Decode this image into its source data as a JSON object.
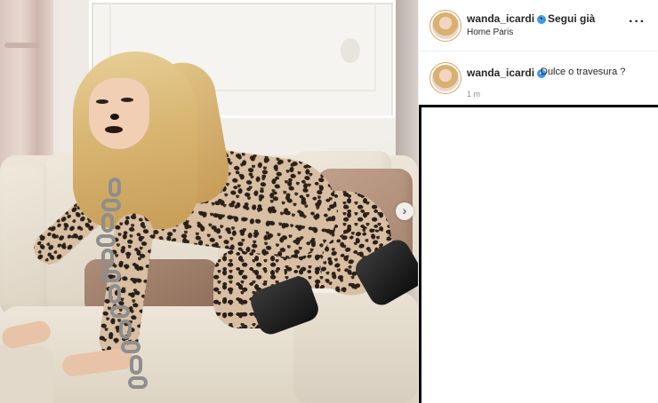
{
  "post": {
    "username": "wanda_icardi",
    "follow_label": "Segui già",
    "separator": "•",
    "location": "Home Paris",
    "more_icon": "more-horizontal-icon",
    "caption": "Dulce o travesura ?",
    "timestamp": "1 m",
    "verified_icon": "verified-badge-icon",
    "next_icon": "chevron-right-icon",
    "next_glyph": "›",
    "more_glyph": "···",
    "check_glyph": "✓"
  },
  "colors": {
    "verified": "#3897f0",
    "text": "#262626",
    "muted": "#8e8e8e"
  }
}
